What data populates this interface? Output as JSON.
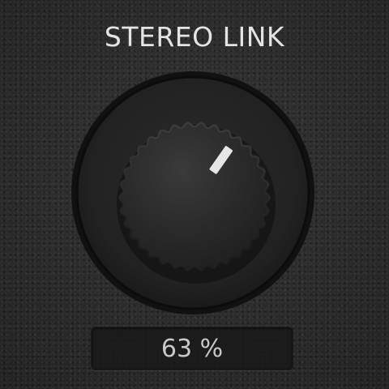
{
  "control": {
    "title": "STEREO LINK",
    "value_text": "63 %",
    "value_fraction": 0.63
  },
  "icons": {
    "knob": "rotary-knob-icon",
    "indicator": "knob-indicator-icon"
  },
  "colors": {
    "title": "#e4e4e4",
    "value_text": "#c8c8c8",
    "indicator": "#e6e6e6",
    "knob_body": "#2a2a2b"
  }
}
